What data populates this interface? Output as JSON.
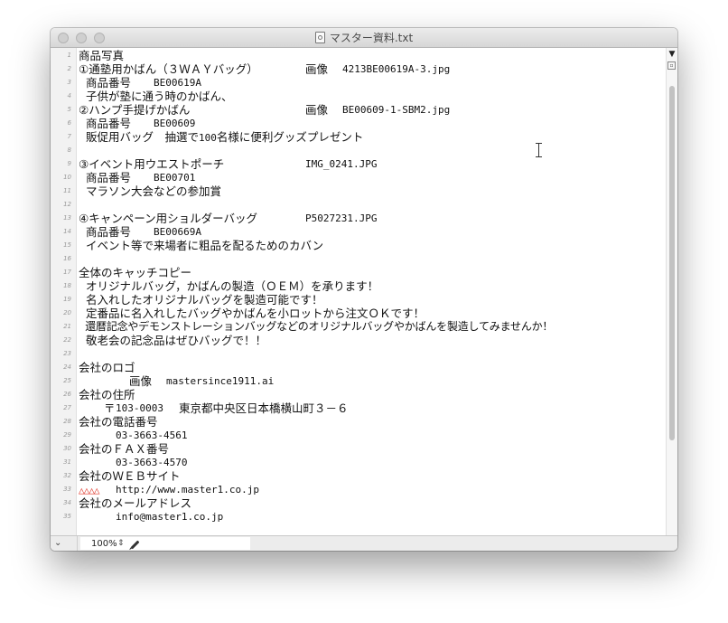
{
  "window": {
    "title": "マスター資料.txt"
  },
  "editor": {
    "line_numbers": [
      "1",
      "2",
      "3",
      "4",
      "5",
      "6",
      "7",
      "8",
      "9",
      "10",
      "11",
      "12",
      "13",
      "14",
      "15",
      "16",
      "17",
      "18",
      "19",
      "20",
      "21",
      "22",
      "23",
      "24",
      "25",
      "26",
      "27",
      "28",
      "29",
      "30",
      "31",
      "32",
      "33",
      "34",
      "35"
    ],
    "lines": {
      "l1": "商品写真",
      "l2a": "①通塾用かばん（３ＷＡＹバッグ）",
      "l2b": "画像",
      "l2c": "4213BE00619A-3.jpg",
      "l3a": "  商品番号",
      "l3b": "BE00619A",
      "l4": "  子供が塾に通う時のかばん、",
      "l5a": "②ハンプ手提げかばん",
      "l5b": "画像",
      "l5c": "BE00609-1-SBM2.jpg",
      "l6a": "  商品番号",
      "l6b": "BE00609",
      "l7a": "  販促用バッグ　抽選で",
      "l7b": "100",
      "l7c": "名様に便利グッズプレゼント",
      "l9a": "③イベント用ウエストポーチ",
      "l9b": "IMG_0241.JPG",
      "l10a": "  商品番号",
      "l10b": "BE00701",
      "l11": "  マラソン大会などの参加賞",
      "l13a": "④キャンペーン用ショルダーバッグ",
      "l13b": "P5027231.JPG",
      "l14a": "  商品番号",
      "l14b": "BE00669A",
      "l15": "  イベント等で来場者に粗品を配るためのカバン",
      "l17": "全体のキャッチコピー",
      "l18": "  オリジナルバッグ，かばんの製造（ＯＥＭ）を承ります！",
      "l19": "  名入れしたオリジナルバッグを製造可能です！",
      "l20": "  定番品に名入れしたバッグやかばんを小ロットから注文ＯＫです！",
      "l21": "  還暦記念やデモンストレーションバッグなどのオリジナルバッグやかばんを製造してみませんか！",
      "l22": "  敬老会の記念品はぜひバッグで！！",
      "l24": "会社のロゴ",
      "l25a": "画像",
      "l25b": "mastersince1911.ai",
      "l26": "会社の住所",
      "l27a": "〒",
      "l27b": "103-0003",
      "l27c": "東京都中央区日本橋横山町３－６",
      "l28": "会社の電話番号",
      "l29": "03-3663-4561",
      "l30": "会社のＦＡＸ番号",
      "l31": "03-3663-4570",
      "l32": "会社のＷＥＢサイト",
      "l33a": "△△△△",
      "l33b": "http://www.master1.co.jp",
      "l34": "会社のメールアドレス",
      "l35": "info@master1.co.jp"
    }
  },
  "statusbar": {
    "zoom": "100%"
  },
  "colors": {
    "tab_marker": "#e0382b"
  },
  "icons": [
    "doc-icon",
    "scroll-up-icon",
    "chevron-down-icon",
    "stepper-icon",
    "pencil-icon",
    "ibeam-cursor-icon"
  ]
}
